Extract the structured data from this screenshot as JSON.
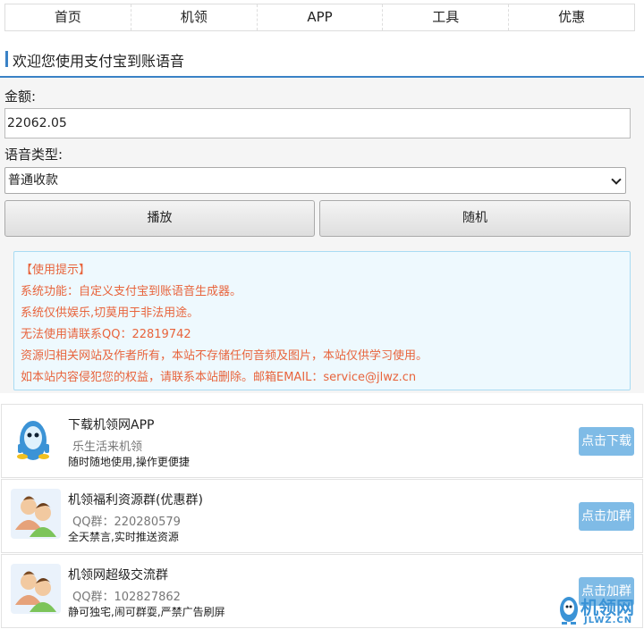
{
  "nav": {
    "items": [
      "首页",
      "机领",
      "APP",
      "工具",
      "优惠"
    ]
  },
  "page": {
    "title": "欢迎您使用支付宝到账语音"
  },
  "form": {
    "amount_label": "金额:",
    "amount_value": "22062.05",
    "voice_type_label": "语音类型:",
    "voice_type_selected": "普通收款",
    "play_button": "播放",
    "random_button": "随机"
  },
  "tips": {
    "heading": "【使用提示】",
    "lines": [
      "系统功能：自定义支付宝到账语音生成器。",
      "系统仅供娱乐,切莫用于非法用途。",
      "无法使用请联系QQ：22819742",
      "资源归相关网站及作者所有，本站不存储任何音频及图片，本站仅供学习使用。",
      "如本站内容侵犯您的权益，请联系本站删除。邮箱EMAIL：service@jlwz.cn"
    ]
  },
  "cards": [
    {
      "title": "下载机领网APP",
      "sub": "乐生活来机领",
      "desc": "随时随地使用,操作更便捷",
      "action": "点击下载",
      "icon": "mascot-icon"
    },
    {
      "title": "机领福利资源群(优惠群)",
      "sub": "QQ群：220280579",
      "desc": "全天禁言,实时推送资源",
      "action": "点击加群",
      "icon": "group-users-icon"
    },
    {
      "title": "机领网超级交流群",
      "sub": "QQ群：102827862",
      "desc": "静可独宅,闹可群耍,严禁广告刷屏",
      "action": "点击加群",
      "icon": "group-users-icon"
    }
  ],
  "watermark": {
    "text": "机领网",
    "domain": "JLWZ.CN"
  },
  "colors": {
    "accent": "#3a82c6",
    "tip_text": "#e8643c",
    "tip_bg": "#eef9fe",
    "action_btn": "#7fbbe6"
  }
}
